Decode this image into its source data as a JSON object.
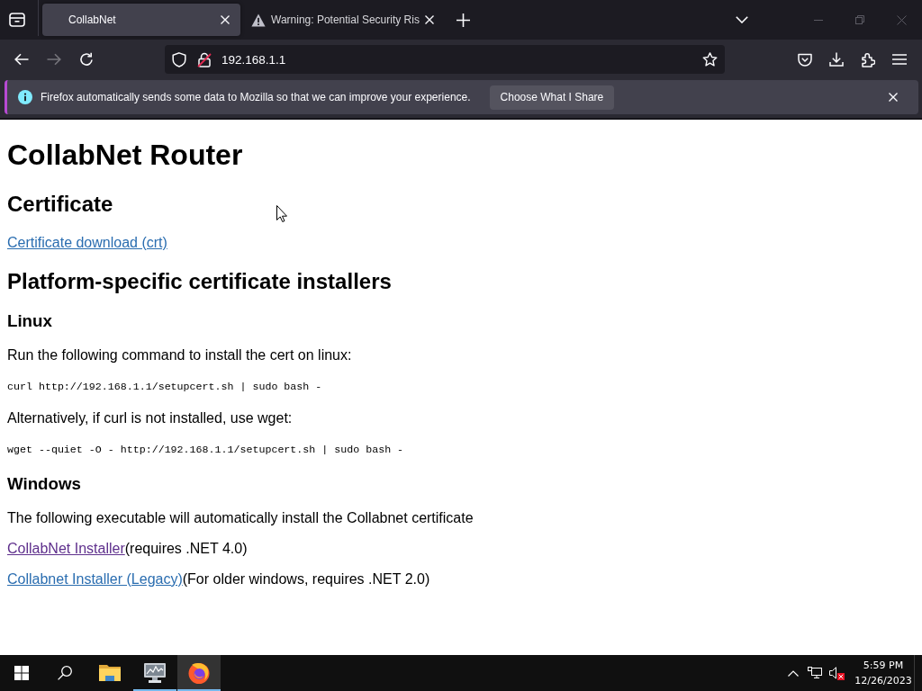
{
  "browser": {
    "tabs": [
      {
        "title": "CollabNet",
        "selected": true,
        "kind": "page"
      },
      {
        "title": "Warning: Potential Security Ris",
        "selected": false,
        "kind": "warning"
      }
    ],
    "nav_buttons": [
      {
        "kind": "back",
        "disabled": false
      },
      {
        "kind": "forward",
        "disabled": true
      },
      {
        "kind": "reload",
        "disabled": false
      }
    ],
    "address": {
      "url": "192.168.1.1",
      "insecure": true
    },
    "notification": {
      "message": "Firefox automatically sends some data to Mozilla so that we can improve your experience.",
      "button": "Choose What I Share"
    }
  },
  "page": {
    "blocks": [
      {
        "kind": "h1",
        "text": "CollabNet Router"
      },
      {
        "kind": "h2",
        "text": "Certificate"
      },
      {
        "kind": "link_line",
        "link": "Certificate download (crt)",
        "visited": false
      },
      {
        "kind": "h2",
        "text": "Platform-specific certificate installers"
      },
      {
        "kind": "h3",
        "text": "Linux"
      },
      {
        "kind": "text",
        "text": "Run the following command to install the cert on linux:"
      },
      {
        "kind": "code",
        "text": "curl http://192.168.1.1/setupcert.sh | sudo bash -"
      },
      {
        "kind": "text",
        "text": "Alternatively, if curl is not installed, use wget:"
      },
      {
        "kind": "code",
        "text": "wget --quiet -O - http://192.168.1.1/setupcert.sh | sudo bash -"
      },
      {
        "kind": "h3",
        "text": "Windows"
      },
      {
        "kind": "text",
        "text": "The following executable will automatically install the Collabnet certificate"
      },
      {
        "kind": "link_line",
        "link": "CollabNet Installer",
        "visited": true,
        "note": "(requires .NET 4.0)"
      },
      {
        "kind": "link_line",
        "link": "Collabnet Installer (Legacy)",
        "visited": false,
        "note": "(For older windows, requires .NET 2.0)"
      }
    ]
  },
  "taskbar": {
    "apps": [
      {
        "kind": "start",
        "running": false,
        "selected": false
      },
      {
        "kind": "search",
        "running": false,
        "selected": false
      },
      {
        "kind": "files",
        "running": false,
        "selected": false
      },
      {
        "kind": "monitor",
        "running": true,
        "selected": false
      },
      {
        "kind": "firefox",
        "running": true,
        "selected": true
      }
    ],
    "tray": {
      "volume_muted": true,
      "time": "5:59 PM",
      "date": "12/26/2023"
    }
  }
}
